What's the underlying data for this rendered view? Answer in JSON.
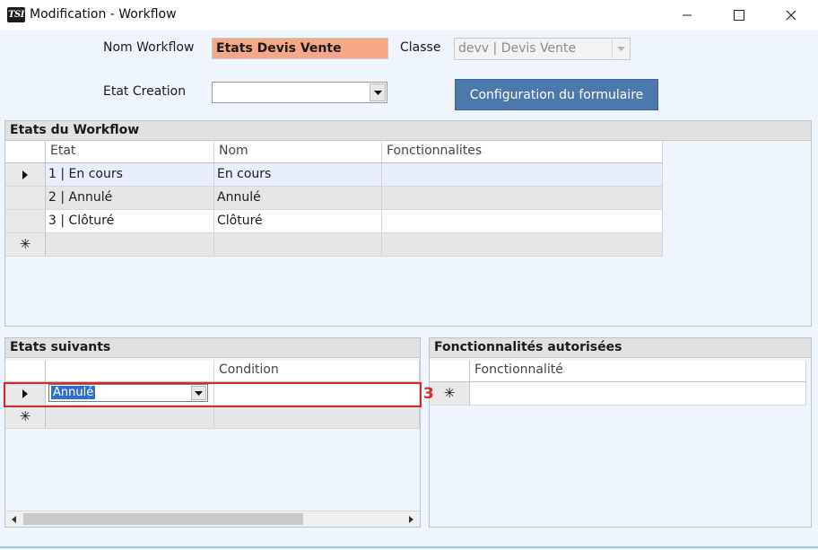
{
  "window": {
    "icon_text": "TSI",
    "title": "Modification - Workflow"
  },
  "form": {
    "nom_label": "Nom Workflow",
    "nom_value": "Etats Devis Vente",
    "classe_label": "Classe",
    "classe_value": "devv | Devis Vente",
    "etat_creation_label": "Etat Creation",
    "etat_creation_value": "",
    "config_button": "Configuration du formulaire"
  },
  "etats": {
    "title": "Etats du Workflow",
    "columns": [
      "Etat",
      "Nom",
      "Fonctionnalites"
    ],
    "rows": [
      {
        "etat": "1 | En cours",
        "nom": "En cours",
        "fonct": ""
      },
      {
        "etat": "2 | Annulé",
        "nom": "Annulé",
        "fonct": ""
      },
      {
        "etat": "3 | Clôturé",
        "nom": "Clôturé",
        "fonct": ""
      }
    ],
    "new_row_marker": "✳"
  },
  "suivants": {
    "title": "Etats suivants",
    "columns": [
      "",
      "Condition"
    ],
    "selected_value": "Annulé",
    "condition_value": "",
    "new_row_marker": "✳"
  },
  "fonctionnalites": {
    "title": "Fonctionnalités autorisées",
    "columns": [
      "Fonctionnalité"
    ],
    "new_row_marker": "✳"
  },
  "annotation": {
    "number": "3",
    "color": "#d42a2a"
  },
  "colors": {
    "name_highlight": "#f6a787",
    "button_blue": "#4c78ab",
    "selected_row": "#e8eefb"
  }
}
